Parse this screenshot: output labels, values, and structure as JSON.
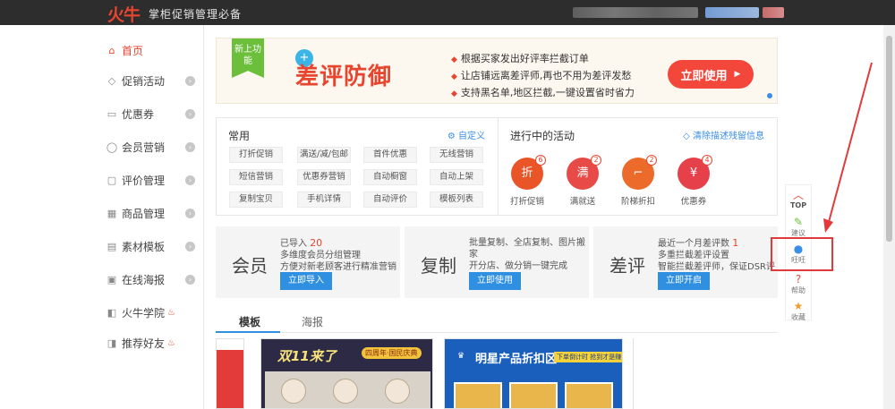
{
  "header": {
    "logo": "火牛",
    "brand": "掌柜促销管理必备",
    "colors": {
      "bg": "#2d2d2d",
      "accent": "#e8452f"
    }
  },
  "sidebar": {
    "items": [
      {
        "label": "首页",
        "icon": "home-icon",
        "glyph": "⌂",
        "active": true
      },
      {
        "label": "促销活动",
        "icon": "tag-icon",
        "glyph": "◇"
      },
      {
        "label": "优惠券",
        "icon": "coupon-icon",
        "glyph": "▭"
      },
      {
        "label": "会员营销",
        "icon": "user-icon",
        "glyph": "◯"
      },
      {
        "label": "评价管理",
        "icon": "comment-icon",
        "glyph": "▢"
      },
      {
        "label": "商品管理",
        "icon": "goods-icon",
        "glyph": "▦"
      },
      {
        "label": "素材模板",
        "icon": "template-icon",
        "glyph": "▤"
      },
      {
        "label": "在线海报",
        "icon": "poster-icon",
        "glyph": "▣"
      },
      {
        "label": "火牛学院",
        "icon": "school-icon",
        "glyph": "◧",
        "hot": true
      },
      {
        "label": "推荐好友",
        "icon": "share-icon",
        "glyph": "◨",
        "hot": true
      }
    ]
  },
  "banner": {
    "flag": "新上功能",
    "title": "差评防御",
    "bullets": [
      "根据买家发出好评率拦截订单",
      "让店铺远离差评师,再也不用为差评发愁",
      "支持黑名单,地区拦截,一键设置省时省力"
    ],
    "button": "立即使用"
  },
  "common_panel": {
    "title": "常用",
    "link": "自定义",
    "chips": [
      "打折促销",
      "满送/减/包邮",
      "首件优惠",
      "无线营销",
      "短信营销",
      "优惠券营销",
      "自动橱窗",
      "自动上架",
      "复制宝贝",
      "手机详情",
      "自动评价",
      "模板列表"
    ]
  },
  "activity_panel": {
    "title": "进行中的活动",
    "link": "清除描述残留信息",
    "items": [
      {
        "label": "打折促销",
        "glyph": "折",
        "count": "6"
      },
      {
        "label": "满就送",
        "glyph": "满",
        "count": "2"
      },
      {
        "label": "阶梯折扣",
        "glyph": "⌐",
        "count": "2"
      },
      {
        "label": "优惠券",
        "glyph": "¥",
        "count": "4"
      }
    ]
  },
  "cards": [
    {
      "big": "会员",
      "line1_pre": "已导入",
      "line1_num": "20",
      "line2": "多维度会员分组管理",
      "line3": "方便对新老顾客进行精准营销",
      "button": "立即导入"
    },
    {
      "big": "复制",
      "line1_pre": "批量复制、全店复制、图片搬家",
      "line1_num": "",
      "line2": "开分店、做分销一键完成",
      "line3": "",
      "button": "立即使用"
    },
    {
      "big": "差评",
      "line1_pre": "最近一个月差评数",
      "line1_num": "1",
      "line2": "多重拦截差评设置",
      "line3": "智能拦截差评师，保证DSR评分",
      "button": "立即开启"
    }
  ],
  "tabs": [
    {
      "label": "模板",
      "active": true
    },
    {
      "label": "海报"
    }
  ],
  "thumbnails": {
    "t1": "双11来了",
    "t1_badge": "四周年·国民庆典",
    "t2": "明星产品折扣区",
    "t2_sub": "下单倒计时 抢到才是赚"
  },
  "toolbar": {
    "items": [
      {
        "label": "TOP",
        "icon": "chevron-up-icon",
        "glyph": "︿"
      },
      {
        "label": "建议",
        "icon": "pencil-icon",
        "glyph": "✎"
      },
      {
        "label": "旺旺",
        "icon": "wangwang-icon",
        "glyph": "●"
      },
      {
        "label": "帮助",
        "icon": "help-icon",
        "glyph": "?"
      },
      {
        "label": "收藏",
        "icon": "star-icon",
        "glyph": "★"
      }
    ]
  }
}
